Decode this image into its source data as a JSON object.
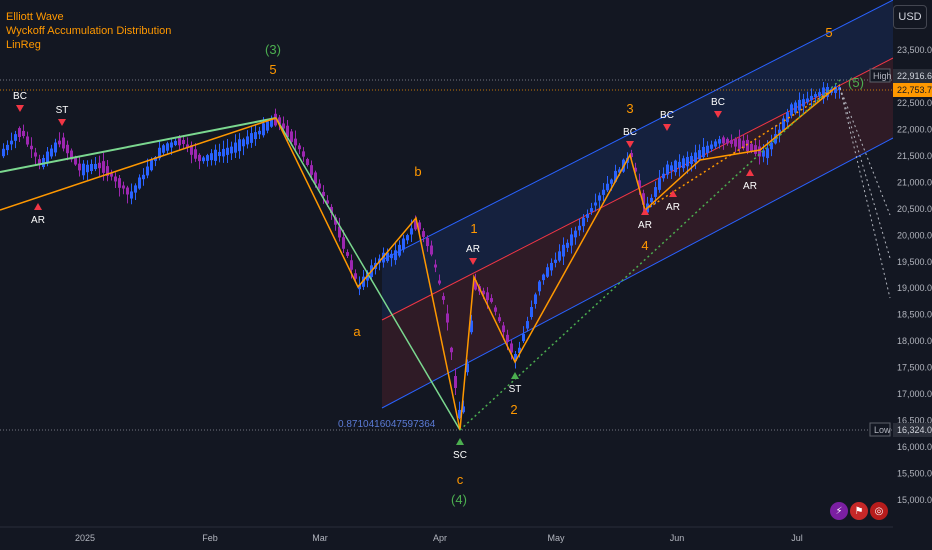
{
  "legend": [
    "Elliott Wave",
    "Wyckoff Accumulation Distribution",
    "LinReg"
  ],
  "currency": "USD",
  "colors": {
    "background": "#131722",
    "up": "#2962ff",
    "down": "#9c27b0",
    "wave": "#ff9800",
    "wave_major": "#4caf50",
    "channel_top": "#2962ff",
    "channel_mid": "#f23645",
    "dotted_green": "#4caf50",
    "dotted_orange": "#ff9800",
    "projection": "#b2b5be"
  },
  "chart_data": {
    "type": "candlestick",
    "ylim": [
      14700,
      23700
    ],
    "y_ticks": [
      "23,500.0",
      "23,000.0",
      "22,500.0",
      "22,000.0",
      "21,500.0",
      "21,000.0",
      "20,500.0",
      "20,000.0",
      "19,500.0",
      "19,000.0",
      "18,500.0",
      "18,000.0",
      "17,500.0",
      "17,000.0",
      "16,500.0",
      "16,000.0",
      "15,500.0",
      "15,000.0"
    ],
    "x_ticks": [
      "2025",
      "Feb",
      "Mar",
      "Apr",
      "May",
      "Jun",
      "Jul"
    ],
    "high_label": "High",
    "high_value": "22,916.6",
    "price_label_value": "22,753.7",
    "low_label": "Low",
    "low_value": "16,324.0",
    "fib_label": "0.8710416047597364",
    "waves": [
      {
        "text": "(3)",
        "color": "wave_major"
      },
      {
        "text": "5",
        "color": "wave"
      },
      {
        "text": "b",
        "color": "wave"
      },
      {
        "text": "a",
        "color": "wave"
      },
      {
        "text": "c",
        "color": "wave"
      },
      {
        "text": "(4)",
        "color": "wave_major"
      },
      {
        "text": "1",
        "color": "wave"
      },
      {
        "text": "2",
        "color": "wave"
      },
      {
        "text": "3",
        "color": "wave"
      },
      {
        "text": "4",
        "color": "wave"
      },
      {
        "text": "5",
        "color": "wave"
      },
      {
        "text": "(5)",
        "color": "wave_major"
      }
    ],
    "wyckoff": [
      "BC",
      "ST",
      "AR",
      "SC",
      "AR",
      "ST",
      "BC",
      "AR",
      "BC",
      "AR",
      "BC",
      "AR"
    ]
  }
}
